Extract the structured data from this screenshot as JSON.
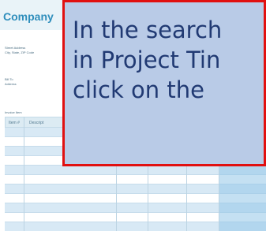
{
  "document": {
    "company_name": "Company",
    "address_line_1": "Street Address",
    "address_line_2": "City, State, ZIP Code",
    "bill_to_label": "Bill To",
    "bill_to_address": "Address",
    "invoice_item_label": "Invoice Item",
    "table_headers": [
      "Item #",
      "Descript"
    ]
  },
  "callout": {
    "line_1": "In the search",
    "line_2": "in Project Tin",
    "line_3": "click on the"
  },
  "colors": {
    "callout_fill": "#b9cbe7",
    "callout_border": "#e11010",
    "callout_text": "#213a73",
    "company_title": "#2f8ebc",
    "header_band": "#e9f3f8"
  }
}
